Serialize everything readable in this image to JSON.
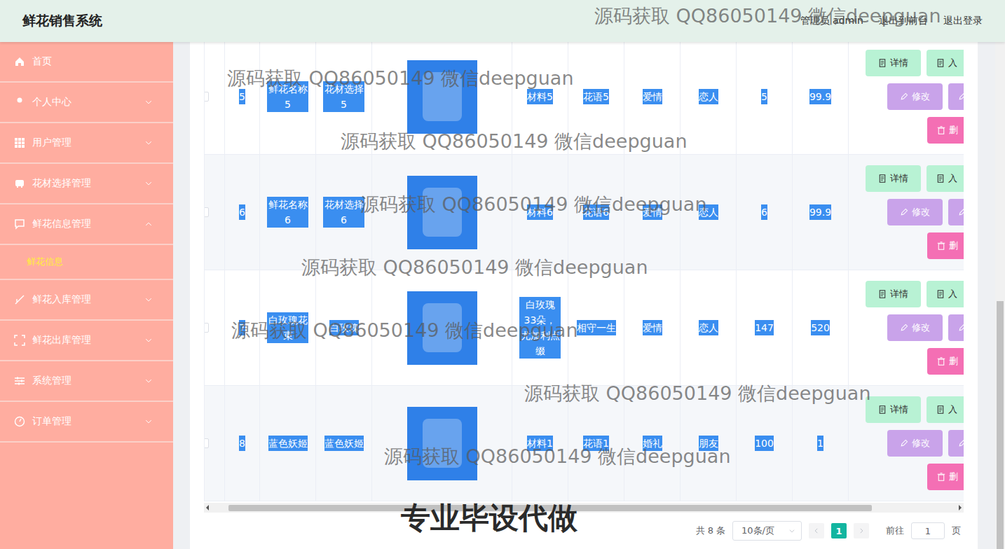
{
  "header": {
    "title": "鲜花销售系统",
    "user": "管理员 admin",
    "links": [
      "退出到前台",
      "退出登录"
    ]
  },
  "sidebar": {
    "items": [
      {
        "label": "首页",
        "icon": "home",
        "expanded": false
      },
      {
        "label": "个人中心",
        "icon": "user",
        "expanded": false
      },
      {
        "label": "用户管理",
        "icon": "grid",
        "expanded": false
      },
      {
        "label": "花材选择管理",
        "icon": "box",
        "expanded": false
      },
      {
        "label": "鲜花信息管理",
        "icon": "chat",
        "expanded": true,
        "children": [
          {
            "label": "鲜花信息",
            "selected": true
          }
        ]
      },
      {
        "label": "鲜花入库管理",
        "icon": "bell",
        "expanded": false
      },
      {
        "label": "鲜花出库管理",
        "icon": "scan",
        "expanded": false
      },
      {
        "label": "系统管理",
        "icon": "sliders",
        "expanded": false
      },
      {
        "label": "订单管理",
        "icon": "gauge",
        "expanded": false
      }
    ]
  },
  "table": {
    "rows": [
      {
        "highlighted": true,
        "cells": [
          "5",
          "鲜花名称5",
          "花材选择5",
          "材料5",
          "花语5",
          "爱情",
          "恋人",
          "5",
          "99.9"
        ]
      },
      {
        "highlighted": true,
        "cells": [
          "6",
          "鲜花名称6",
          "花材选择6",
          "材料6",
          "花语6",
          "爱情",
          "恋人",
          "6",
          "99.9"
        ]
      },
      {
        "highlighted": true,
        "cells": [
          "7",
          "白玫瑰花束",
          "白玫瑰",
          "白玫瑰33朵，尤加利点缀",
          "相守一生",
          "爱情",
          "恋人",
          "147",
          "520"
        ]
      },
      {
        "highlighted": true,
        "cells": [
          "8",
          "蓝色妖姬",
          "蓝色妖姬",
          "材料1",
          "花语1",
          "婚礼",
          "朋友",
          "100",
          "1"
        ]
      }
    ],
    "actions": [
      [
        {
          "label": "详情",
          "color": "#b8f2d4"
        },
        {
          "label": "入",
          "color": "#b8f2d4"
        }
      ],
      [
        {
          "label": "修改",
          "color": "#c9a3ea"
        },
        {
          "color": "#c9a3ea"
        }
      ],
      [
        {
          "label": "删",
          "color": "#f46fb4"
        }
      ]
    ]
  },
  "pagination": {
    "total": "共 8 条",
    "page_size": "10条/页",
    "current": "1",
    "goto": "前往",
    "goto_value": "1",
    "unit": "页"
  },
  "watermarks": [
    "源码获取 QQ86050149 微信deepguan",
    "源码获取 QQ86050149 微信deepguan",
    "源码获取 QQ86050149 微信deepguan",
    "源码获取 QQ86050149 微信deepguan",
    "源码获取 QQ86050149 微信deepguan",
    "源码获取 QQ86050149 微信deepguan",
    "源码获取 QQ86050149 微信deepguan",
    "源码获取 QQ86050149 微信deepguan"
  ],
  "banner": "专业毕设代做"
}
